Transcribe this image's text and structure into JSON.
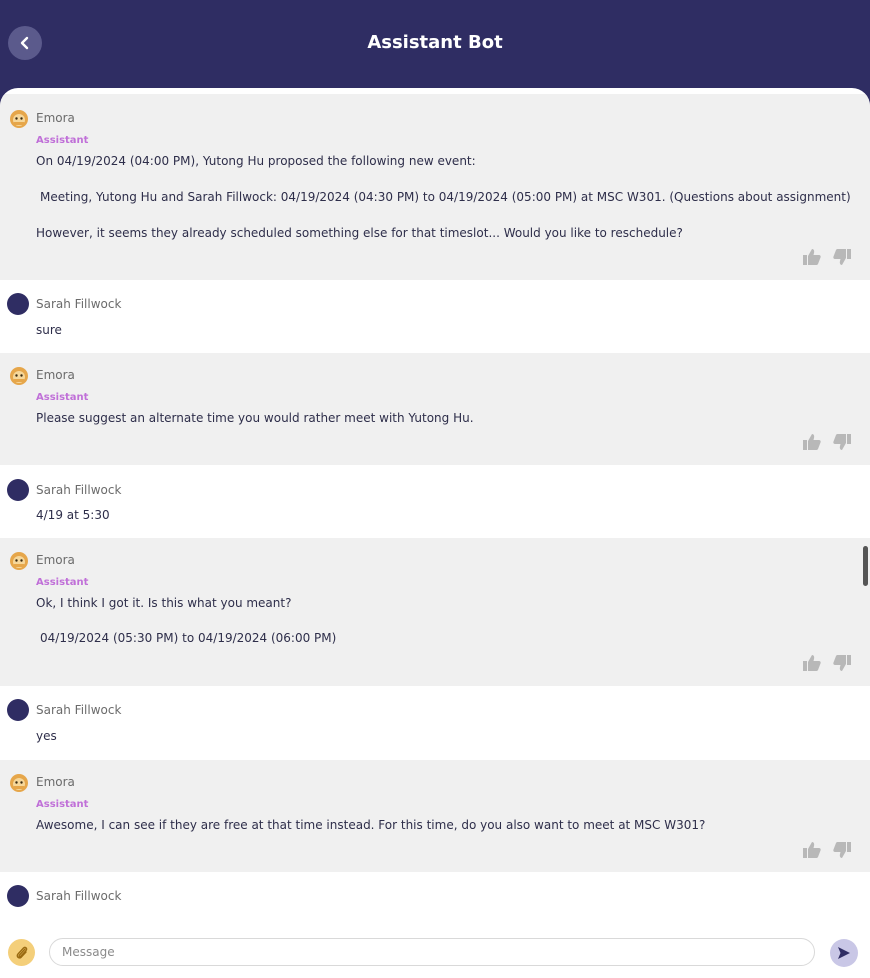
{
  "header": {
    "title": "Assistant Bot"
  },
  "messages": [
    {
      "type": "bot",
      "sender": "Emora",
      "role": "Assistant",
      "lines": [
        "On 04/19/2024 (04:00 PM), Yutong Hu proposed the following new event:",
        "Meeting, Yutong Hu and Sarah Fillwock: 04/19/2024 (04:30 PM) to 04/19/2024 (05:00 PM) at MSC W301. (Questions about assignment)",
        "However, it seems they already scheduled something else for that timeslot... Would you like to reschedule?"
      ]
    },
    {
      "type": "user",
      "sender": "Sarah Fillwock",
      "lines": [
        "sure"
      ]
    },
    {
      "type": "bot",
      "sender": "Emora",
      "role": "Assistant",
      "lines": [
        "Please suggest an alternate time you would rather meet with Yutong Hu."
      ]
    },
    {
      "type": "user",
      "sender": "Sarah Fillwock",
      "lines": [
        "4/19 at 5:30"
      ]
    },
    {
      "type": "bot",
      "sender": "Emora",
      "role": "Assistant",
      "lines": [
        "Ok, I think I got it. Is this what you meant?",
        "04/19/2024 (05:30 PM) to 04/19/2024 (06:00 PM)"
      ]
    },
    {
      "type": "user",
      "sender": "Sarah Fillwock",
      "lines": [
        "yes"
      ]
    },
    {
      "type": "bot",
      "sender": "Emora",
      "role": "Assistant",
      "lines": [
        "Awesome, I can see if they are free at that time instead. For this time, do you also want to meet at MSC W301?"
      ]
    },
    {
      "type": "user",
      "sender": "Sarah Fillwock",
      "lines": []
    }
  ],
  "composer": {
    "placeholder": "Message"
  },
  "icons": {
    "back": "chevron-left-icon",
    "attach": "paperclip-icon",
    "send": "send-icon",
    "like": "thumbs-up-icon",
    "dislike": "thumbs-down-icon",
    "bot_avatar": "monkey-avatar-icon"
  },
  "colors": {
    "header": "#2f2d63",
    "role": "#c070d8",
    "bot_bg": "#f0f0f0",
    "user_avatar": "#2f2d63",
    "attach": "#f4cf7a"
  }
}
